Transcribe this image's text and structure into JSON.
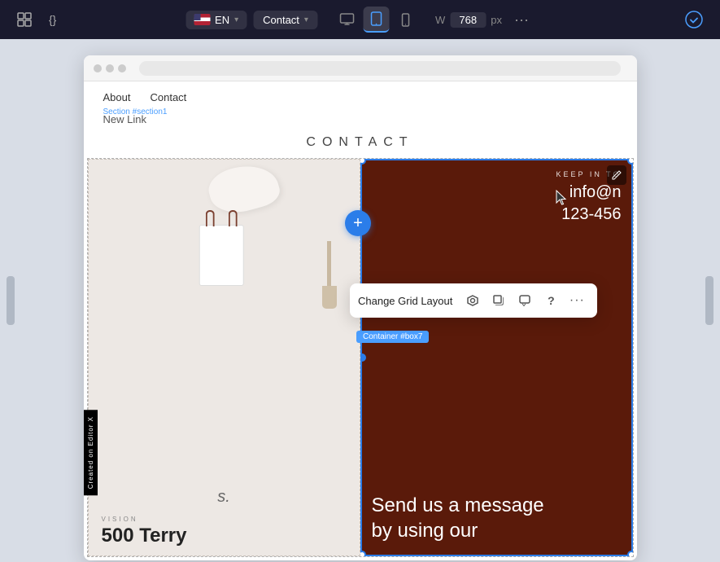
{
  "toolbar": {
    "lang": "EN",
    "page": "Contact",
    "width_label": "W",
    "width_value": "768",
    "width_unit": "px",
    "devices": [
      {
        "id": "desktop",
        "label": "Desktop",
        "icon": "⬜"
      },
      {
        "id": "tablet-landscape",
        "label": "Tablet Landscape",
        "icon": "⬜",
        "active": true
      },
      {
        "id": "mobile",
        "label": "Mobile",
        "icon": "📱"
      }
    ],
    "more_icon": "···",
    "checkmark_icon": "✓"
  },
  "browser": {
    "url_placeholder": ""
  },
  "site": {
    "nav_links": [
      "About",
      "Contact"
    ],
    "section_label": "Section #section1",
    "contact_title": "CONTACT",
    "new_link": "New Link",
    "vision_label": "VISION",
    "number": "500 Terry",
    "email": "info@n",
    "phone": "123-456",
    "keep_in_touch": "KEEP IN TO",
    "send_message_line1": "Send us a message",
    "send_message_line2": "by using our"
  },
  "grid_toolbar": {
    "label": "Change Grid Layout",
    "actions": [
      {
        "id": "diamond",
        "icon": "◈",
        "title": "Grid settings"
      },
      {
        "id": "copy",
        "icon": "⧉",
        "title": "Duplicate"
      },
      {
        "id": "comment",
        "icon": "💬",
        "title": "Comment"
      },
      {
        "id": "help",
        "icon": "?",
        "title": "Help"
      },
      {
        "id": "more",
        "icon": "···",
        "title": "More"
      }
    ]
  },
  "container_tag": "Container #box7",
  "editor_badge": "Created on Editor X",
  "colors": {
    "accent_blue": "#2b7de9",
    "dark_brown": "#5a1a0a",
    "nav_bg": "#f0eeed",
    "toolbar_bg": "#1a1a2e"
  }
}
